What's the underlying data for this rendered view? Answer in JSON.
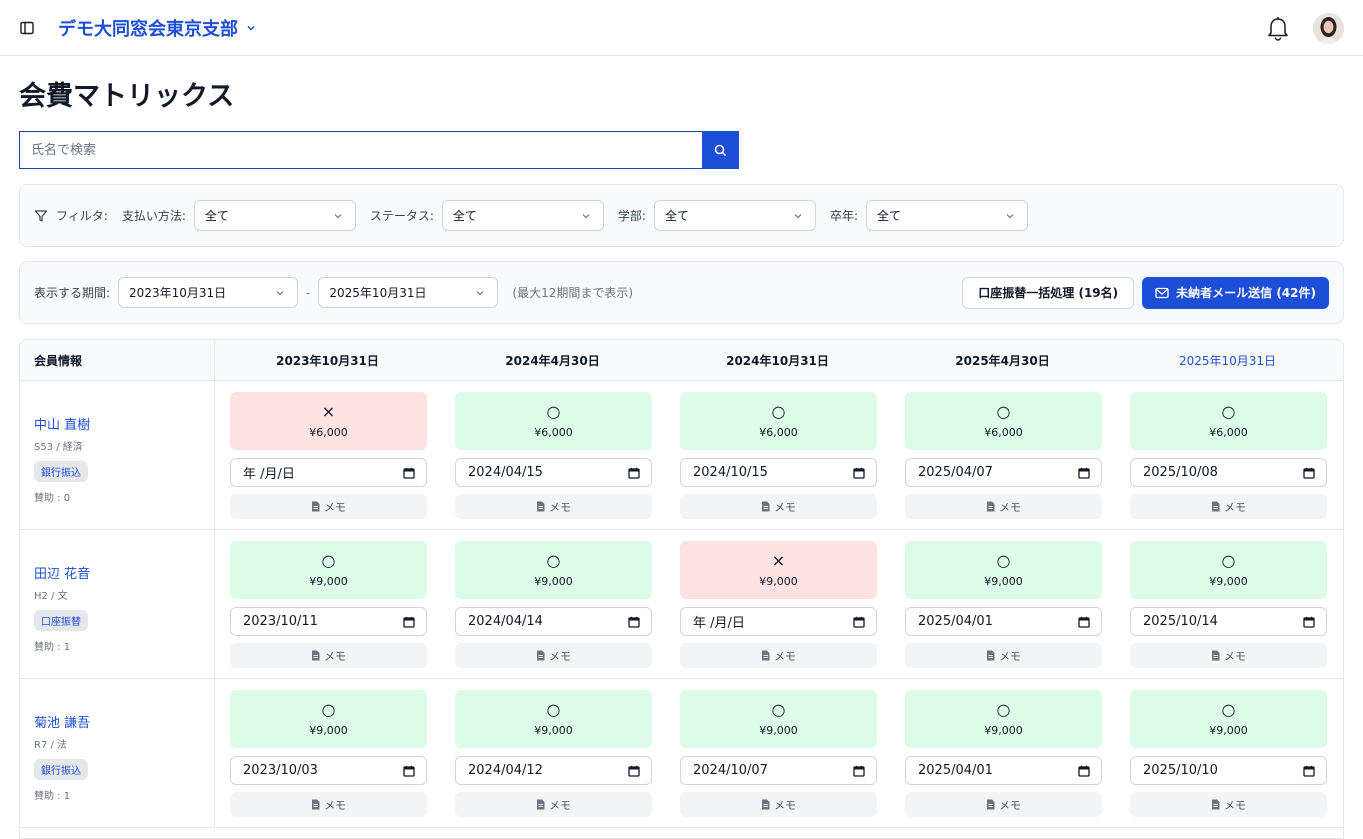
{
  "header": {
    "org_name": "デモ大同窓会東京支部",
    "icons": [
      "sidebar-toggle-icon",
      "chevron-down-icon",
      "bell-icon",
      "avatar"
    ]
  },
  "page": {
    "title": "会費マトリックス"
  },
  "search": {
    "placeholder": "氏名で検索",
    "value": ""
  },
  "filters": {
    "label": "フィルタ:",
    "payment_method": {
      "label": "支払い方法:",
      "value": "全て"
    },
    "status": {
      "label": "ステータス:",
      "value": "全て"
    },
    "faculty": {
      "label": "学部:",
      "value": "全て"
    },
    "grad_year": {
      "label": "卒年:",
      "value": "全て"
    }
  },
  "period": {
    "label": "表示する期間:",
    "start": "2023年10月31日",
    "separator": "-",
    "end": "2025年10月31日",
    "hint": "(最大12期間まで表示)",
    "bulk_button": "口座振替一括処理 (19名)",
    "mail_button": "未納者メール送信 (42件)"
  },
  "matrix": {
    "member_header": "会員情報",
    "periods": [
      "2023年10月31日",
      "2024年4月30日",
      "2024年10月31日",
      "2025年4月30日",
      "2025年10月31日"
    ],
    "current_period_index": 4,
    "memo_label": "メモ",
    "members": [
      {
        "name": "中山 直樹",
        "meta": "S53 / 経済",
        "method": "銀行振込",
        "support": "賛助 : 0",
        "cells": [
          {
            "status": "unpaid",
            "mark": "×",
            "amount": "¥6,000",
            "date": "年 /月/日"
          },
          {
            "status": "paid",
            "mark": "○",
            "amount": "¥6,000",
            "date": "2024/04/15"
          },
          {
            "status": "paid",
            "mark": "○",
            "amount": "¥6,000",
            "date": "2024/10/15"
          },
          {
            "status": "paid",
            "mark": "○",
            "amount": "¥6,000",
            "date": "2025/04/07"
          },
          {
            "status": "paid",
            "mark": "○",
            "amount": "¥6,000",
            "date": "2025/10/08"
          }
        ]
      },
      {
        "name": "田辺 花音",
        "meta": "H2 / 文",
        "method": "口座振替",
        "support": "賛助 : 1",
        "cells": [
          {
            "status": "paid",
            "mark": "○",
            "amount": "¥9,000",
            "date": "2023/10/11"
          },
          {
            "status": "paid",
            "mark": "○",
            "amount": "¥9,000",
            "date": "2024/04/14"
          },
          {
            "status": "unpaid",
            "mark": "×",
            "amount": "¥9,000",
            "date": "年 /月/日"
          },
          {
            "status": "paid",
            "mark": "○",
            "amount": "¥9,000",
            "date": "2025/04/01"
          },
          {
            "status": "paid",
            "mark": "○",
            "amount": "¥9,000",
            "date": "2025/10/14"
          }
        ]
      },
      {
        "name": "菊池 謙吾",
        "meta": "R7 / 法",
        "method": "銀行振込",
        "support": "賛助 : 1",
        "cells": [
          {
            "status": "paid",
            "mark": "○",
            "amount": "¥9,000",
            "date": "2023/10/03"
          },
          {
            "status": "paid",
            "mark": "○",
            "amount": "¥9,000",
            "date": "2024/04/12"
          },
          {
            "status": "paid",
            "mark": "○",
            "amount": "¥9,000",
            "date": "2024/10/07"
          },
          {
            "status": "paid",
            "mark": "○",
            "amount": "¥9,000",
            "date": "2025/04/01"
          },
          {
            "status": "paid",
            "mark": "○",
            "amount": "¥9,000",
            "date": "2025/10/10"
          }
        ]
      }
    ]
  },
  "colors": {
    "accent": "#1d4ed8",
    "paid_bg": "#dcfce7",
    "unpaid_bg": "#fee2e2",
    "panel_bg": "#f9fafb"
  }
}
